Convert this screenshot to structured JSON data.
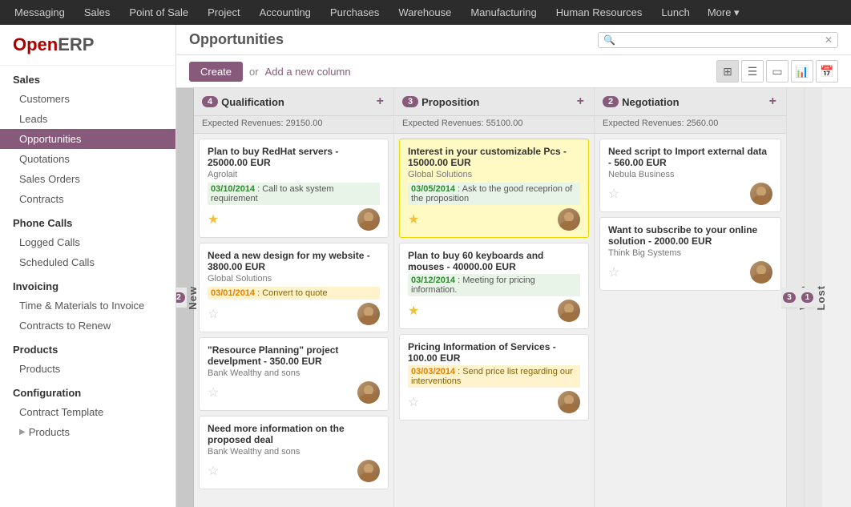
{
  "topnav": {
    "items": [
      {
        "label": "Messaging",
        "active": false
      },
      {
        "label": "Sales",
        "active": false
      },
      {
        "label": "Point of Sale",
        "active": false
      },
      {
        "label": "Project",
        "active": false
      },
      {
        "label": "Accounting",
        "active": false
      },
      {
        "label": "Purchases",
        "active": false
      },
      {
        "label": "Warehouse",
        "active": false
      },
      {
        "label": "Manufacturing",
        "active": false
      },
      {
        "label": "Human Resources",
        "active": false
      },
      {
        "label": "Lunch",
        "active": false
      },
      {
        "label": "More",
        "active": false
      }
    ]
  },
  "sidebar": {
    "logo_open": "Open",
    "logo_erp": "ERP",
    "sections": [
      {
        "title": "Sales",
        "items": [
          {
            "label": "Customers",
            "active": false
          },
          {
            "label": "Leads",
            "active": false
          },
          {
            "label": "Opportunities",
            "active": true
          },
          {
            "label": "Quotations",
            "active": false
          },
          {
            "label": "Sales Orders",
            "active": false
          },
          {
            "label": "Contracts",
            "active": false
          }
        ]
      },
      {
        "title": "Phone Calls",
        "items": [
          {
            "label": "Logged Calls",
            "active": false
          },
          {
            "label": "Scheduled Calls",
            "active": false
          }
        ]
      },
      {
        "title": "Invoicing",
        "items": [
          {
            "label": "Time & Materials to Invoice",
            "active": false
          },
          {
            "label": "Contracts to Renew",
            "active": false
          }
        ]
      },
      {
        "title": "Products",
        "items": [
          {
            "label": "Products",
            "active": false
          }
        ]
      },
      {
        "title": "Configuration",
        "items": [
          {
            "label": "Contract Template",
            "active": false
          },
          {
            "label": "Products",
            "active": false,
            "has_arrow": true
          }
        ]
      }
    ]
  },
  "content": {
    "title": "Opportunities",
    "search_placeholder": "",
    "toolbar": {
      "create_label": "Create",
      "or_label": "or",
      "add_column_label": "Add a new column"
    }
  },
  "columns": [
    {
      "id": "new",
      "label": "New",
      "is_folded_label": true
    },
    {
      "id": "qualification",
      "title": "Qualification",
      "badge": "4",
      "expected": "Expected Revenues: 29150.00",
      "cards": [
        {
          "id": "c1",
          "title": "Plan to buy RedHat servers - 25000.00 EUR",
          "company": "Agrolait",
          "activity_date": "03/10/2014",
          "activity_text": "Call to ask system requirement",
          "activity_color": "green",
          "star_filled": true,
          "highlighted": false
        },
        {
          "id": "c2",
          "title": "Need a new design for my website - 3800.00 EUR",
          "company": "Global Solutions",
          "activity_date": "03/01/2014",
          "activity_text": "Convert to quote",
          "activity_color": "orange",
          "star_filled": false,
          "highlighted": false
        },
        {
          "id": "c3",
          "title": "\"Resource Planning\" project develpment - 350.00 EUR",
          "company": "Bank Wealthy and sons",
          "activity_date": "",
          "activity_text": "",
          "activity_color": "",
          "star_filled": false,
          "highlighted": false
        },
        {
          "id": "c4",
          "title": "Need more information on the proposed deal",
          "company": "Bank Wealthy and sons",
          "activity_date": "",
          "activity_text": "",
          "activity_color": "",
          "star_filled": false,
          "highlighted": false
        }
      ]
    },
    {
      "id": "proposition",
      "title": "Proposition",
      "badge": "3",
      "expected": "Expected Revenues: 55100.00",
      "cards": [
        {
          "id": "p1",
          "title": "Interest in your customizable Pcs - 15000.00 EUR",
          "company": "Global Solutions",
          "activity_date": "03/05/2014",
          "activity_text": "Ask to the good receprion of the proposition",
          "activity_color": "green",
          "star_filled": true,
          "highlighted": true
        },
        {
          "id": "p2",
          "title": "Plan to buy 60 keyboards and mouses - 40000.00 EUR",
          "company": "",
          "activity_date": "03/12/2014",
          "activity_text": "Meeting for pricing information.",
          "activity_color": "green",
          "star_filled": true,
          "highlighted": false
        },
        {
          "id": "p3",
          "title": "Pricing Information of Services - 100.00 EUR",
          "company": "",
          "activity_date": "03/03/2014",
          "activity_text": "Send price list regarding our interventions",
          "activity_color": "orange",
          "star_filled": false,
          "highlighted": false
        }
      ]
    },
    {
      "id": "negotiation",
      "title": "Negotiation",
      "badge": "2",
      "expected": "Expected Revenues: 2560.00",
      "cards": [
        {
          "id": "n1",
          "title": "Need script to Import external data - 560.00 EUR",
          "company": "Nebula Business",
          "activity_date": "",
          "activity_text": "",
          "activity_color": "",
          "star_filled": false,
          "highlighted": false
        },
        {
          "id": "n2",
          "title": "Want to subscribe to your online solution - 2000.00 EUR",
          "company": "Think Big Systems",
          "activity_date": "",
          "activity_text": "",
          "activity_color": "",
          "star_filled": false,
          "highlighted": false
        }
      ]
    },
    {
      "id": "won",
      "label": "Won",
      "badge": "3",
      "is_folded_label": true
    },
    {
      "id": "lost",
      "label": "Lost",
      "badge": "1",
      "is_folded_label": true
    }
  ]
}
